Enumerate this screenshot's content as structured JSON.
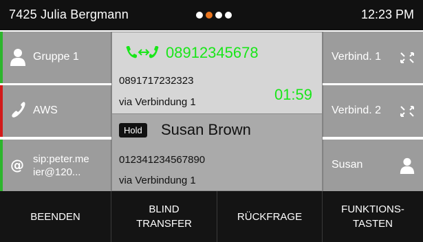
{
  "header": {
    "owner": "7425 Julia Bergmann",
    "clock": "12:23 PM",
    "page_dots": [
      "inactive",
      "active",
      "inactive",
      "inactive"
    ]
  },
  "left_keys": [
    {
      "label": "Gruppe 1",
      "icon": "person-icon",
      "bar_color": "#2db52d"
    },
    {
      "label": "AWS",
      "icon": "handset-icon",
      "bar_color": "#d21a1a"
    },
    {
      "label_line1": "sip:peter.me",
      "label_line2": "ier@120...",
      "icon": "at-sign-icon",
      "bar_color": "#2db52d"
    }
  ],
  "right_keys": [
    {
      "label": "Verbind. 1",
      "icon": "connect-arrows-icon"
    },
    {
      "label": "Verbind. 2",
      "icon": "connect-arrows-icon"
    },
    {
      "label": "Susan",
      "icon": "person-icon"
    }
  ],
  "active_call": {
    "number": "08912345678",
    "caller_number": "0891717232323",
    "via": "via Verbindung 1",
    "duration": "01:59",
    "accent": "#19e619"
  },
  "held_call": {
    "status": "Hold",
    "name": "Susan Brown",
    "number": "012341234567890",
    "via": "via Verbindung 1"
  },
  "softkeys": {
    "k1": "BEENDEN",
    "k2_line1": "BLIND",
    "k2_line2": "TRANSFER",
    "k3": "RÜCKFRAGE",
    "k4_line1": "FUNKTIONS-",
    "k4_line2": "TASTEN"
  }
}
